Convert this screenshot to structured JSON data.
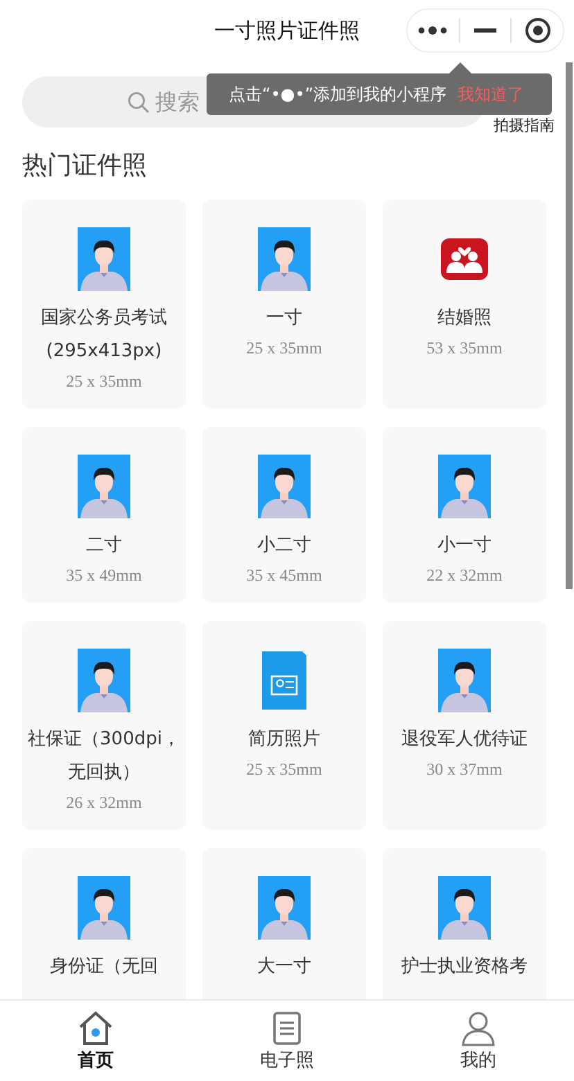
{
  "nav_bar": {
    "title": "一寸照片证件照"
  },
  "search": {
    "placeholder": "搜索"
  },
  "tooltip": {
    "text": "点击“•●•”添加到我的小程序",
    "action": "我知道了"
  },
  "guide": {
    "label": "拍摄指南"
  },
  "section": {
    "title": "热门证件照"
  },
  "items": [
    {
      "kind": "photo",
      "name": "国家公务员考试(295x413px)",
      "size": "25 x 35mm"
    },
    {
      "kind": "photo",
      "name": "一寸",
      "size": "25 x 35mm"
    },
    {
      "kind": "marriage",
      "name": "结婚照",
      "size": "53 x 35mm"
    },
    {
      "kind": "photo",
      "name": "二寸",
      "size": "35 x 49mm"
    },
    {
      "kind": "photo",
      "name": "小二寸",
      "size": "35 x 45mm"
    },
    {
      "kind": "photo",
      "name": "小一寸",
      "size": "22 x 32mm"
    },
    {
      "kind": "photo",
      "name": "社保证（300dpi，无回执）",
      "size": "26 x 32mm"
    },
    {
      "kind": "cv",
      "name": "简历照片",
      "size": "25 x 35mm"
    },
    {
      "kind": "photo",
      "name": "退役军人优待证",
      "size": "30 x 37mm"
    },
    {
      "kind": "photo",
      "name": "身份证（无回"
    },
    {
      "kind": "photo",
      "name": "大一寸"
    },
    {
      "kind": "photo",
      "name": "护士执业资格考"
    }
  ],
  "tabs": [
    {
      "kind": "home",
      "label": "首页",
      "selected": true
    },
    {
      "kind": "doc",
      "label": "电子照",
      "selected": false
    },
    {
      "kind": "user",
      "label": "我的",
      "selected": false
    }
  ]
}
